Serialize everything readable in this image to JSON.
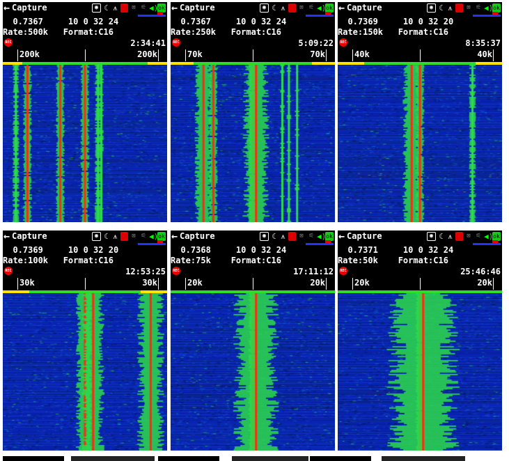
{
  "app": {
    "back_arrow": "←",
    "title": "Capture",
    "icons": [
      "camera-icon",
      "moon-icon",
      "antenna-icon",
      "record-icon",
      "lock-icon",
      "signal-icon",
      "speaker-icon",
      "ok-icon"
    ],
    "rec_label": "REC",
    "colors": {
      "background": "#000000",
      "text": "#ffffff",
      "bar_green": "#2ddc2d",
      "bar_yellow": "#ffe400",
      "rec_red": "#e00000",
      "waterfall_bg": "#0a2ab8",
      "signal_core": "#ff2a10",
      "signal_halo": "#2ddc4a"
    }
  },
  "panels": [
    {
      "line1": "  0.7367     10 0 32 24",
      "line2": "Rate:500k   Format:C16",
      "time": "2:34:41",
      "left_label": "200k",
      "right_label": "200k",
      "bar_yellow": [
        [
          0.0,
          0.12
        ],
        [
          0.88,
          1.0
        ]
      ]
    },
    {
      "line1": "  0.7367     10 0 32 24",
      "line2": "Rate:250k   Format:C16",
      "time": "5:09:22",
      "left_label": "70k",
      "right_label": "70k",
      "bar_yellow": [
        [
          0.0,
          0.14
        ],
        [
          0.86,
          1.0
        ]
      ]
    },
    {
      "line1": "  0.7369     10 0 32 20",
      "line2": "Rate:150k   Format:C16",
      "time": "8:35:37",
      "left_label": "40k",
      "right_label": "40k",
      "bar_yellow": [
        [
          0.0,
          0.16
        ],
        [
          0.84,
          1.0
        ]
      ]
    },
    {
      "line1": "  0.7369     10 0 32 20",
      "line2": "Rate:100k   Format:C16",
      "time": "12:53:25",
      "left_label": "30k",
      "right_label": "30k",
      "bar_yellow": [
        [
          0.0,
          0.16
        ],
        [
          0.84,
          1.0
        ]
      ]
    },
    {
      "line1": "  0.7368     10 0 32 24",
      "line2": "Rate:75k    Format:C16",
      "time": "17:11:12",
      "left_label": "20k",
      "right_label": "20k",
      "bar_yellow": []
    },
    {
      "line1": "  0.7371     10 0 32 24",
      "line2": "Rate:50k    Format:C16",
      "time": "25:46:46",
      "left_label": "20k",
      "right_label": "20k",
      "bar_yellow": []
    }
  ]
}
